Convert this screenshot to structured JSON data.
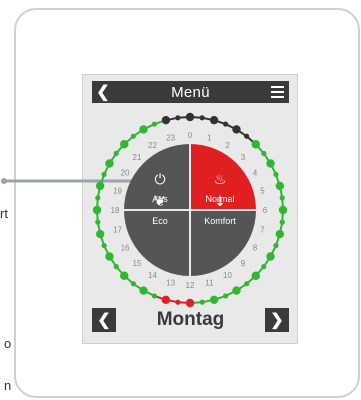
{
  "header": {
    "back_icon": "chevron-left-icon",
    "title": "Menü",
    "menu_icon": "hamburger-icon"
  },
  "clock": {
    "hour_labels": [
      "0",
      "1",
      "2",
      "3",
      "4",
      "5",
      "6",
      "7",
      "8",
      "9",
      "10",
      "11",
      "12",
      "13",
      "14",
      "15",
      "16",
      "17",
      "18",
      "19",
      "20",
      "21",
      "22",
      "23"
    ],
    "colors": {
      "normal": "#2eb82e",
      "comfort": "#e02020",
      "eco": "#333333"
    },
    "slots": [
      "eco",
      "eco",
      "eco",
      "eco",
      "eco",
      "eco",
      "normal",
      "normal",
      "normal",
      "normal",
      "normal",
      "normal",
      "normal",
      "normal",
      "normal",
      "normal",
      "normal",
      "normal",
      "normal",
      "normal",
      "normal",
      "normal",
      "normal",
      "normal",
      "comfort",
      "comfort",
      "comfort",
      "normal",
      "normal",
      "normal",
      "normal",
      "normal",
      "normal",
      "normal",
      "normal",
      "normal",
      "normal",
      "normal",
      "normal",
      "normal",
      "normal",
      "normal",
      "normal",
      "normal",
      "normal",
      "normal",
      "eco",
      "eco"
    ]
  },
  "modes": [
    {
      "label": "Aus",
      "icon": "power-icon",
      "color": "#555555",
      "active": false
    },
    {
      "label": "Normal",
      "icon": "flame-icon",
      "color": "#e02020",
      "active": true
    },
    {
      "label": "Eco",
      "icon": "leaf-icon",
      "color": "#555555",
      "active": false
    },
    {
      "label": "Komfort",
      "icon": "thermometer-icon",
      "color": "#555555",
      "active": false
    }
  ],
  "footer": {
    "prev_icon": "chevron-left-icon",
    "day": "Montag",
    "next_icon": "chevron-right-icon"
  },
  "side_fragments": {
    "right_cut": "rt",
    "bottom_cut_1": "o",
    "bottom_cut_2": "n"
  }
}
